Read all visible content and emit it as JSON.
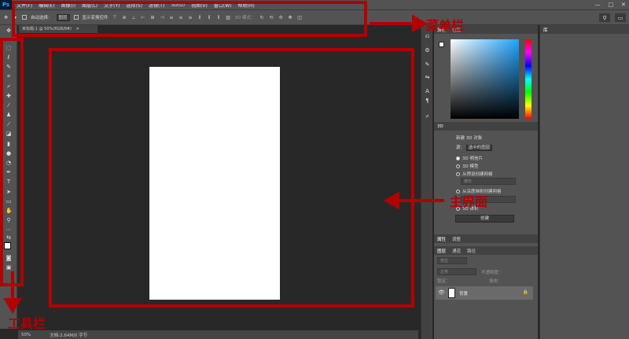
{
  "app": {
    "logo": "Ps"
  },
  "menubar": {
    "items": [
      "文件(F)",
      "编辑(E)",
      "图像(I)",
      "图层(L)",
      "文字(Y)",
      "选择(S)",
      "滤镜(T)",
      "3D(D)",
      "视图(V)",
      "窗口(W)",
      "帮助(H)"
    ],
    "window_controls": [
      "—",
      "□",
      "✕"
    ]
  },
  "options": {
    "auto_select_label": "自动选择：",
    "auto_select_value": "图层",
    "show_transform_label": "显示变换控件",
    "mode_3d_label": "3D 模式："
  },
  "document": {
    "tab_title": "未标题-1 @ 50%(RGB/8#)"
  },
  "statusbar": {
    "zoom": "50%",
    "doc_info": "文档:2.64M/0 字节"
  },
  "panels": {
    "color_tabs": [
      "颜色",
      "色板"
    ],
    "library_tab": "库",
    "p3d_tab": "3D",
    "p3d": {
      "new_object_label": "新建 3D 对象",
      "source_label": "源：",
      "source_value": "选中的图层",
      "options": [
        "3D 明信片",
        "3D 模型",
        "从预设创建网格"
      ],
      "preset_placeholder": "锥形",
      "depth_map_label": "从深度映射创建网格",
      "depth_field": "平面",
      "volume_label": "3D 体积",
      "create_button": "创建"
    },
    "props_tabs": [
      "属性",
      "调整"
    ],
    "layers_tabs": [
      "图层",
      "通道",
      "路径"
    ],
    "layers": {
      "kind_filter": "类型",
      "blend_mode": "正常",
      "opacity_label": "不透明度：",
      "lock_label": "锁定：",
      "fill_label": "填充：",
      "background_layer": "背景"
    }
  },
  "annotations": {
    "menubar_label": "菜单栏",
    "main_area_label": "主界面",
    "tools_label": "工具栏",
    "color": "#b20000"
  }
}
